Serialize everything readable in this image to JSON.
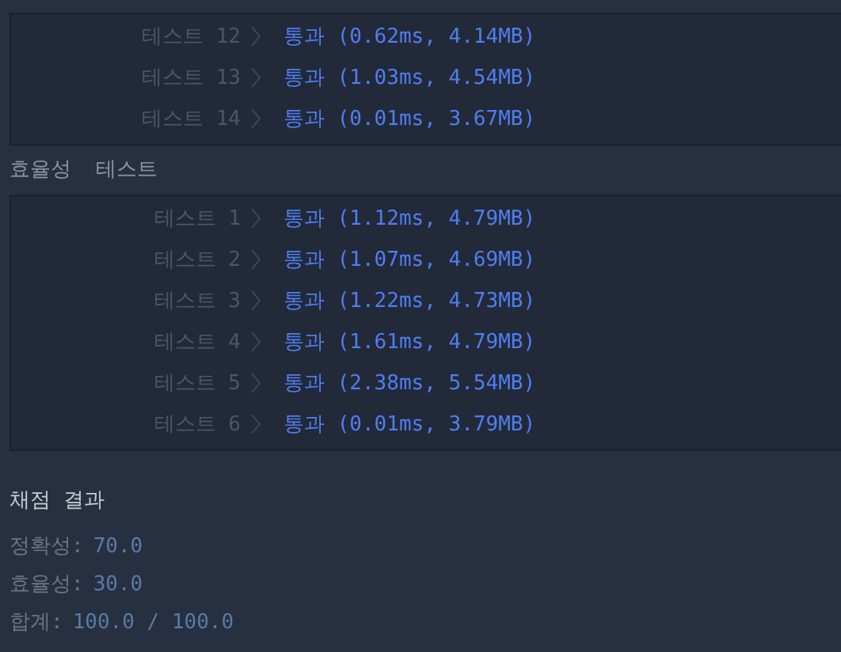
{
  "sections": [
    {
      "tests": [
        {
          "label": "테스트 12",
          "result": "통과 (0.62ms, 4.14MB)"
        },
        {
          "label": "테스트 13",
          "result": "통과 (1.03ms, 4.54MB)"
        },
        {
          "label": "테스트 14",
          "result": "통과 (0.01ms, 3.67MB)"
        }
      ]
    },
    {
      "heading": "효율성  테스트",
      "tests": [
        {
          "label": "테스트 1",
          "result": "통과 (1.12ms, 4.79MB)"
        },
        {
          "label": "테스트 2",
          "result": "통과 (1.07ms, 4.69MB)"
        },
        {
          "label": "테스트 3",
          "result": "통과 (1.22ms, 4.73MB)"
        },
        {
          "label": "테스트 4",
          "result": "통과 (1.61ms, 4.79MB)"
        },
        {
          "label": "테스트 5",
          "result": "통과 (2.38ms, 5.54MB)"
        },
        {
          "label": "테스트 6",
          "result": "통과 (0.01ms, 3.79MB)"
        }
      ]
    }
  ],
  "grading": {
    "title": "채점 결과",
    "lines": [
      {
        "label": "정확성:",
        "value": "70.0"
      },
      {
        "label": "효율성:",
        "value": "30.0"
      },
      {
        "label": "합계:",
        "value": "100.0 / 100.0"
      }
    ]
  }
}
